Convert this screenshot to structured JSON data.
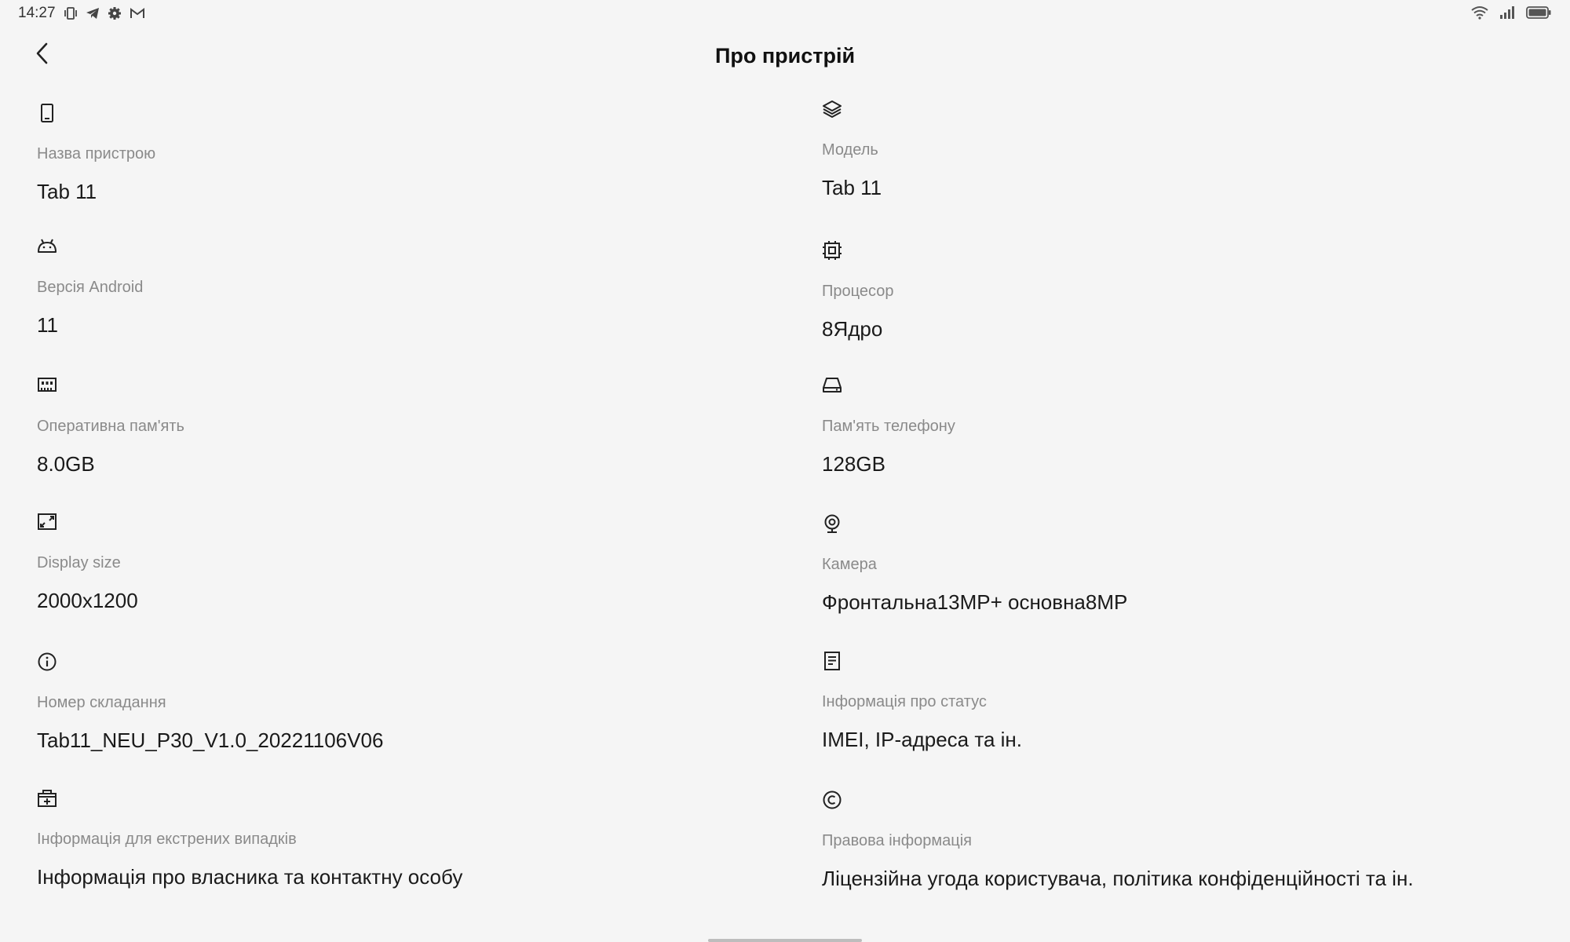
{
  "status_bar": {
    "time": "14:27",
    "left_icons": [
      "vibrate-icon",
      "telegram-icon",
      "gear-icon",
      "gmail-icon"
    ],
    "right_icons": [
      "wifi-icon",
      "signal-icon",
      "battery-icon"
    ]
  },
  "app_bar": {
    "title": "Про пристрій",
    "back_icon": "chevron-left-icon"
  },
  "left_items": [
    {
      "icon": "tablet-icon",
      "label": "Назва пристрою",
      "value": "Tab 11"
    },
    {
      "icon": "android-icon",
      "label": "Версія Android",
      "value": "11"
    },
    {
      "icon": "ram-icon",
      "label": "Оперативна пам'ять",
      "value": "8.0GB"
    },
    {
      "icon": "display-size-icon",
      "label": "Display size",
      "value": "2000x1200"
    },
    {
      "icon": "info-icon",
      "label": "Номер складання",
      "value": "Tab11_NEU_P30_V1.0_20221106V06"
    },
    {
      "icon": "emergency-kit-icon",
      "label": "Інформація для екстрених випадків",
      "value": "Інформація про власника та контактну особу"
    }
  ],
  "right_items": [
    {
      "icon": "layers-icon",
      "label": "Модель",
      "value": "Tab 11"
    },
    {
      "icon": "cpu-icon",
      "label": "Процесор",
      "value": "8Ядро"
    },
    {
      "icon": "storage-icon",
      "label": "Пам'ять телефону",
      "value": "128GB"
    },
    {
      "icon": "camera-icon",
      "label": "Камера",
      "value": "Фронтальна13MP+ основна8MP"
    },
    {
      "icon": "document-icon",
      "label": "Інформація про статус",
      "value": "IMEI, IP-адреса та ін."
    },
    {
      "icon": "copyright-icon",
      "label": "Правова інформація",
      "value": "Ліцензійна угода користувача, політика конфіденційності та ін."
    }
  ]
}
